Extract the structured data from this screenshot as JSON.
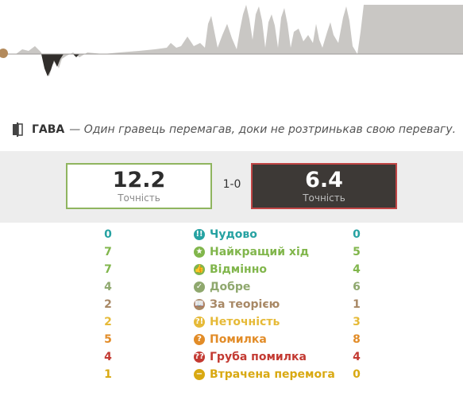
{
  "annotation": {
    "icon": "balance-icon",
    "term": "ГАВА",
    "description": "— Один гравець перемагав, доки не розтринькав свою перевагу."
  },
  "summary": {
    "white": {
      "value": "12.2",
      "label": "Точність"
    },
    "black": {
      "value": "6.4",
      "label": "Точність"
    },
    "score": "1-0"
  },
  "classifications": [
    {
      "white": "0",
      "name": "Чудово",
      "black": "0",
      "color": "#26a2a2",
      "icon": "!!"
    },
    {
      "white": "7",
      "name": "Найкращий хід",
      "black": "5",
      "color": "#81b64c",
      "icon": "★"
    },
    {
      "white": "7",
      "name": "Відмінно",
      "black": "4",
      "color": "#81b64c",
      "icon": "👍"
    },
    {
      "white": "4",
      "name": "Добре",
      "black": "6",
      "color": "#8fa86e",
      "icon": "✓"
    },
    {
      "white": "2",
      "name": "За теорією",
      "black": "1",
      "color": "#a88865",
      "icon": "📖"
    },
    {
      "white": "2",
      "name": "Неточність",
      "black": "3",
      "color": "#e6ba38",
      "icon": "?!"
    },
    {
      "white": "5",
      "name": "Помилка",
      "black": "8",
      "color": "#e28c28",
      "icon": "?"
    },
    {
      "white": "4",
      "name": "Груба помилка",
      "black": "4",
      "color": "#c33a32",
      "icon": "??"
    },
    {
      "white": "1",
      "name": "Втрачена перемога",
      "black": "0",
      "color": "#d9a912",
      "icon": "−"
    }
  ]
}
